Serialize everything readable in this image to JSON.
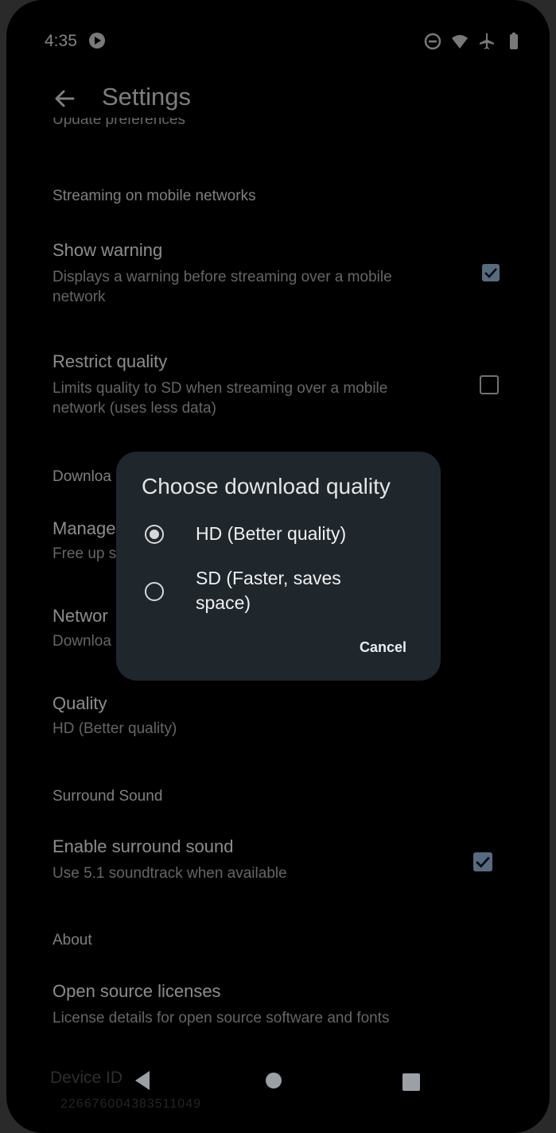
{
  "status_bar": {
    "time": "4:35",
    "icons": [
      "app-notification-icon",
      "do-not-disturb-icon",
      "wifi-icon",
      "airplane-icon",
      "battery-icon"
    ]
  },
  "appbar": {
    "title": "Settings",
    "back_icon": "back-arrow-icon"
  },
  "peek": {
    "text": "Update preferences"
  },
  "sections": {
    "streaming": "Streaming on mobile networks",
    "downloads": "Downloa",
    "surround": "Surround Sound",
    "about": "About"
  },
  "prefs": {
    "show_warning": {
      "title": "Show warning",
      "summary": "Displays a warning before streaming over a mobile network",
      "checked": true
    },
    "restrict_quality": {
      "title": "Restrict quality",
      "summary": "Limits quality to SD when streaming over a mobile network (uses less data)",
      "checked": false
    },
    "manage": {
      "title": "Manage",
      "summary": "Free up s"
    },
    "network": {
      "title": "Networ",
      "summary": "Downloa"
    },
    "quality": {
      "title": "Quality",
      "summary": "HD (Better quality)"
    },
    "surround_sound": {
      "title": "Enable surround sound",
      "summary": "Use 5.1 soundtrack when available",
      "checked": true
    },
    "licenses": {
      "title": "Open source licenses",
      "summary": "License details for open source software and fonts"
    },
    "device_id": {
      "title": "Device ID",
      "value": "226676004383511049"
    }
  },
  "dialog": {
    "title": "Choose download quality",
    "options": [
      {
        "label": "HD (Better quality)",
        "selected": true
      },
      {
        "label": "SD (Faster, saves space)",
        "selected": false
      }
    ],
    "cancel": "Cancel"
  },
  "colors": {
    "background": "#000000",
    "dialog": "#1f272d",
    "checkbox_accent": "#9ec4e8"
  }
}
